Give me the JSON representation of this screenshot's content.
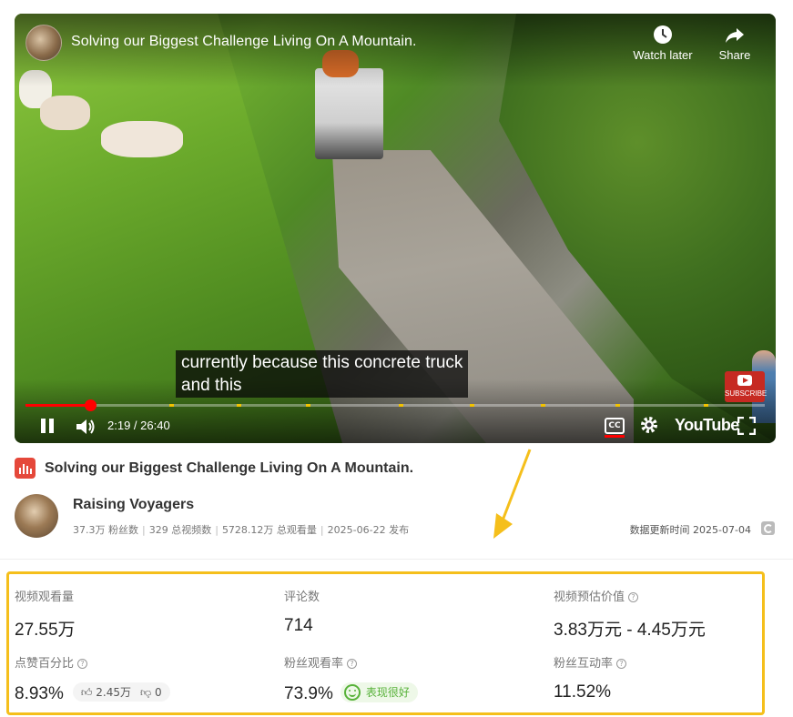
{
  "player": {
    "title": "Solving our Biggest Challenge Living On A Mountain.",
    "watch_later_label": "Watch later",
    "share_label": "Share",
    "caption_line1": "currently because this concrete truck",
    "caption_line2": "and this",
    "subscribe_label": "SUBSCRIBE",
    "time_display": "2:19 / 26:40",
    "progress_fraction": 0.0869,
    "cc_label": "CC",
    "youtube_wordmark": "YouTube"
  },
  "info": {
    "title": "Solving our Biggest Challenge Living On A Mountain.",
    "channel_name": "Raising Voyagers",
    "stats": [
      "37.3万 粉丝数",
      "329 总视频数",
      "5728.12万 总观看量",
      "2025-06-22 发布"
    ],
    "updated_label": "数据更新时间 2025-07-04"
  },
  "metrics": {
    "views": {
      "label": "视频观看量",
      "value": "27.55万"
    },
    "comments": {
      "label": "评论数",
      "value": "714"
    },
    "est_value": {
      "label": "视频预估价值",
      "value": "3.83万元 - 4.45万元"
    },
    "like_ratio": {
      "label": "点赞百分比",
      "value": "8.93%",
      "likes": "2.45万",
      "dislikes": "0"
    },
    "fan_view_rate": {
      "label": "粉丝观看率",
      "value": "73.9%",
      "badge": "表现很好"
    },
    "fan_engagement": {
      "label": "粉丝互动率",
      "value": "11.52%"
    }
  },
  "colors": {
    "highlight_border": "#f5bf1b",
    "progress_red": "#ff0000",
    "good_green": "#58b23a",
    "chart_icon_red": "#e5483a"
  },
  "icons": [
    "clock-icon",
    "share-arrow-icon",
    "pause-icon",
    "volume-icon",
    "cc-icon",
    "gear-icon",
    "fullscreen-icon",
    "bar-chart-icon",
    "refresh-icon",
    "help-icon",
    "thumbs-up-icon",
    "thumbs-down-icon",
    "smile-icon"
  ]
}
